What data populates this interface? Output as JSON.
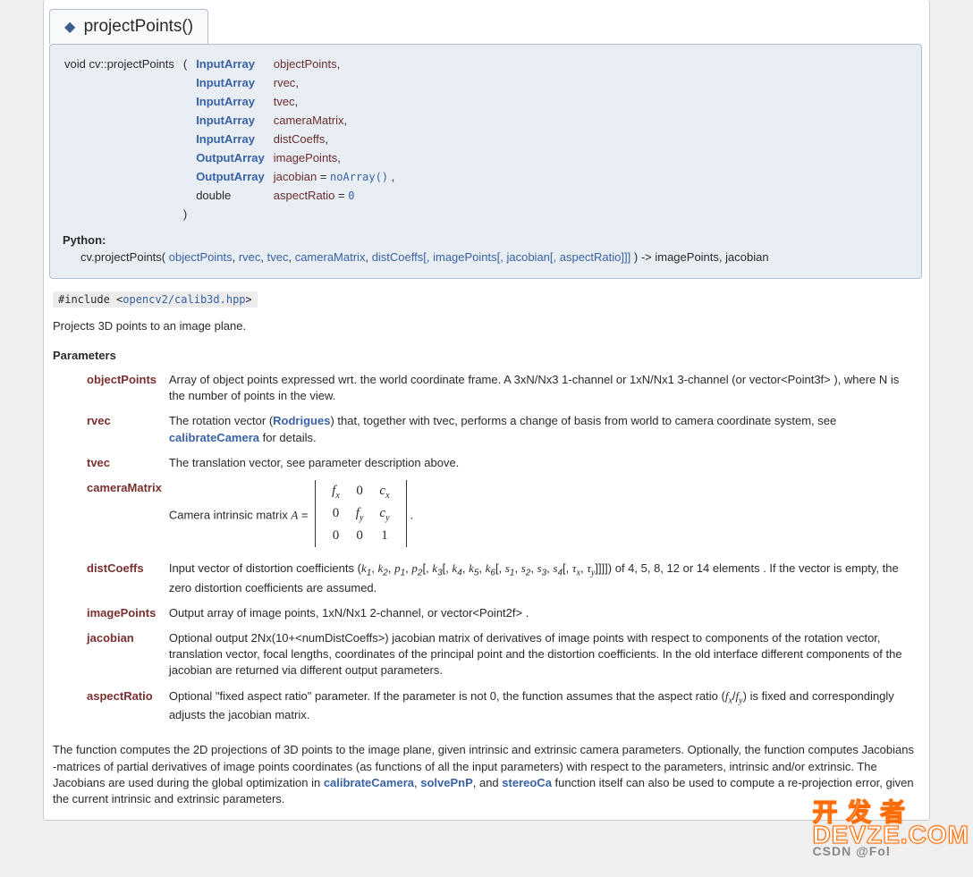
{
  "section": {
    "title": "projectPoints()"
  },
  "signature": {
    "qualifier": "void cv::projectPoints",
    "open": "(",
    "close": ")",
    "params": [
      {
        "type": "InputArray",
        "name": "objectPoints",
        "suffix": ","
      },
      {
        "type": "InputArray",
        "name": "rvec",
        "suffix": ","
      },
      {
        "type": "InputArray",
        "name": "tvec",
        "suffix": ","
      },
      {
        "type": "InputArray",
        "name": "cameraMatrix",
        "suffix": ","
      },
      {
        "type": "InputArray",
        "name": "distCoeffs",
        "suffix": ","
      },
      {
        "type": "OutputArray",
        "name": "imagePoints",
        "suffix": ","
      },
      {
        "type": "OutputArray",
        "name": "jacobian",
        "default": "noArray()",
        "suffix": ","
      },
      {
        "type": "double",
        "name": "aspectRatio",
        "default": "0",
        "suffix": ""
      }
    ],
    "python_label": "Python:",
    "python_prefix": "cv.projectPoints(",
    "python_args": [
      "objectPoints",
      "rvec",
      "tvec",
      "cameraMatrix",
      "distCoeffs"
    ],
    "python_optional": "[, imagePoints[, jacobian[, aspectRatio]]]",
    "python_close": ")",
    "python_ret": "-> imagePoints, jacobian"
  },
  "include": {
    "prefix": "#include <",
    "path": "opencv2/calib3d.hpp",
    "suffix": ">"
  },
  "brief": "Projects 3D points to an image plane.",
  "params_title": "Parameters",
  "parameters": {
    "objectPoints": "Array of object points expressed wrt. the world coordinate frame. A 3xN/Nx3 1-channel or 1xN/Nx1 3-channel (or vector<Point3f> ), where N is the number of points in the view.",
    "rvec_pre": "The rotation vector (",
    "rvec_link": "Rodrigues",
    "rvec_mid": ") that, together with tvec, performs a change of basis from world to camera coordinate system, see ",
    "rvec_link2": "calibrateCamera",
    "rvec_post": " for details.",
    "tvec": "The translation vector, see parameter description above.",
    "cameraMatrix_pre": "Camera intrinsic matrix ",
    "distCoeffs_pre": "Input vector of distortion coefficients ",
    "distCoeffs_post": " of 4, 5, 8, 12 or 14 elements . If the vector is empty, the zero distortion coefficients are assumed.",
    "imagePoints": "Output array of image points, 1xN/Nx1 2-channel, or vector<Point2f> .",
    "jacobian": "Optional output 2Nx(10+<numDistCoeffs>) jacobian matrix of derivatives of image points with respect to components of the rotation vector, translation vector, focal lengths, coordinates of the principal point and the distortion coefficients. In the old interface different components of the jacobian are returned via different output parameters.",
    "aspectRatio_pre": "Optional \"fixed aspect ratio\" parameter. If the parameter is not 0, the function assumes that the aspect ratio (",
    "aspectRatio_post": ") is fixed and correspondingly adjusts the jacobian matrix."
  },
  "param_names": {
    "objectPoints": "objectPoints",
    "rvec": "rvec",
    "tvec": "tvec",
    "cameraMatrix": "cameraMatrix",
    "distCoeffs": "distCoeffs",
    "imagePoints": "imagePoints",
    "jacobian": "jacobian",
    "aspectRatio": "aspectRatio"
  },
  "long": {
    "p1a": "The function computes the 2D projections of 3D points to the image plane, given intrinsic and extrinsic camera parameters. Optionally, the function computes Jacobians -matrices of partial derivatives of image points coordinates (as functions of all the input parameters) with respect to the parameters, intrinsic and/or extrinsic. The Jacobians are used during the global optimization in ",
    "link1": "calibrateCamera",
    "sep1": ", ",
    "link2": "solvePnP",
    "sep2": ", and ",
    "link3": "stereoCa",
    "p1b": " function itself can also be used to compute a re-projection error, given the current intrinsic and extrinsic parameters."
  },
  "watermark": {
    "line1": "开 发 者",
    "line2": "DEVZE.COM",
    "sub": "CSDN @Fol"
  }
}
